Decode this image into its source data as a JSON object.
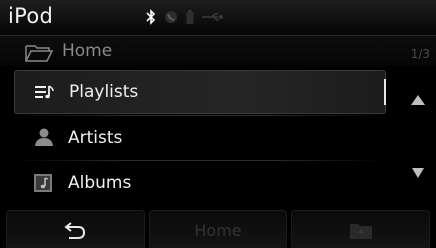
{
  "header": {
    "app_title": "iPod",
    "status_icons": [
      "bluetooth-icon",
      "phone-icon",
      "battery-icon",
      "usb-icon"
    ]
  },
  "path": {
    "label": "Home",
    "page_count": "1/3"
  },
  "menu": {
    "items": [
      {
        "label": "Playlists",
        "icon": "playlist-icon",
        "selected": true
      },
      {
        "label": "Artists",
        "icon": "artist-icon",
        "selected": false
      },
      {
        "label": "Albums",
        "icon": "album-icon",
        "selected": false
      }
    ]
  },
  "footer": {
    "back_icon": "back-arrow-icon",
    "home_label": "Home",
    "folder_icon": "folder-icon"
  },
  "colors": {
    "background": "#000000",
    "text": "#f0f0f0",
    "muted": "#8a8a8a",
    "disabled": "#333333"
  }
}
